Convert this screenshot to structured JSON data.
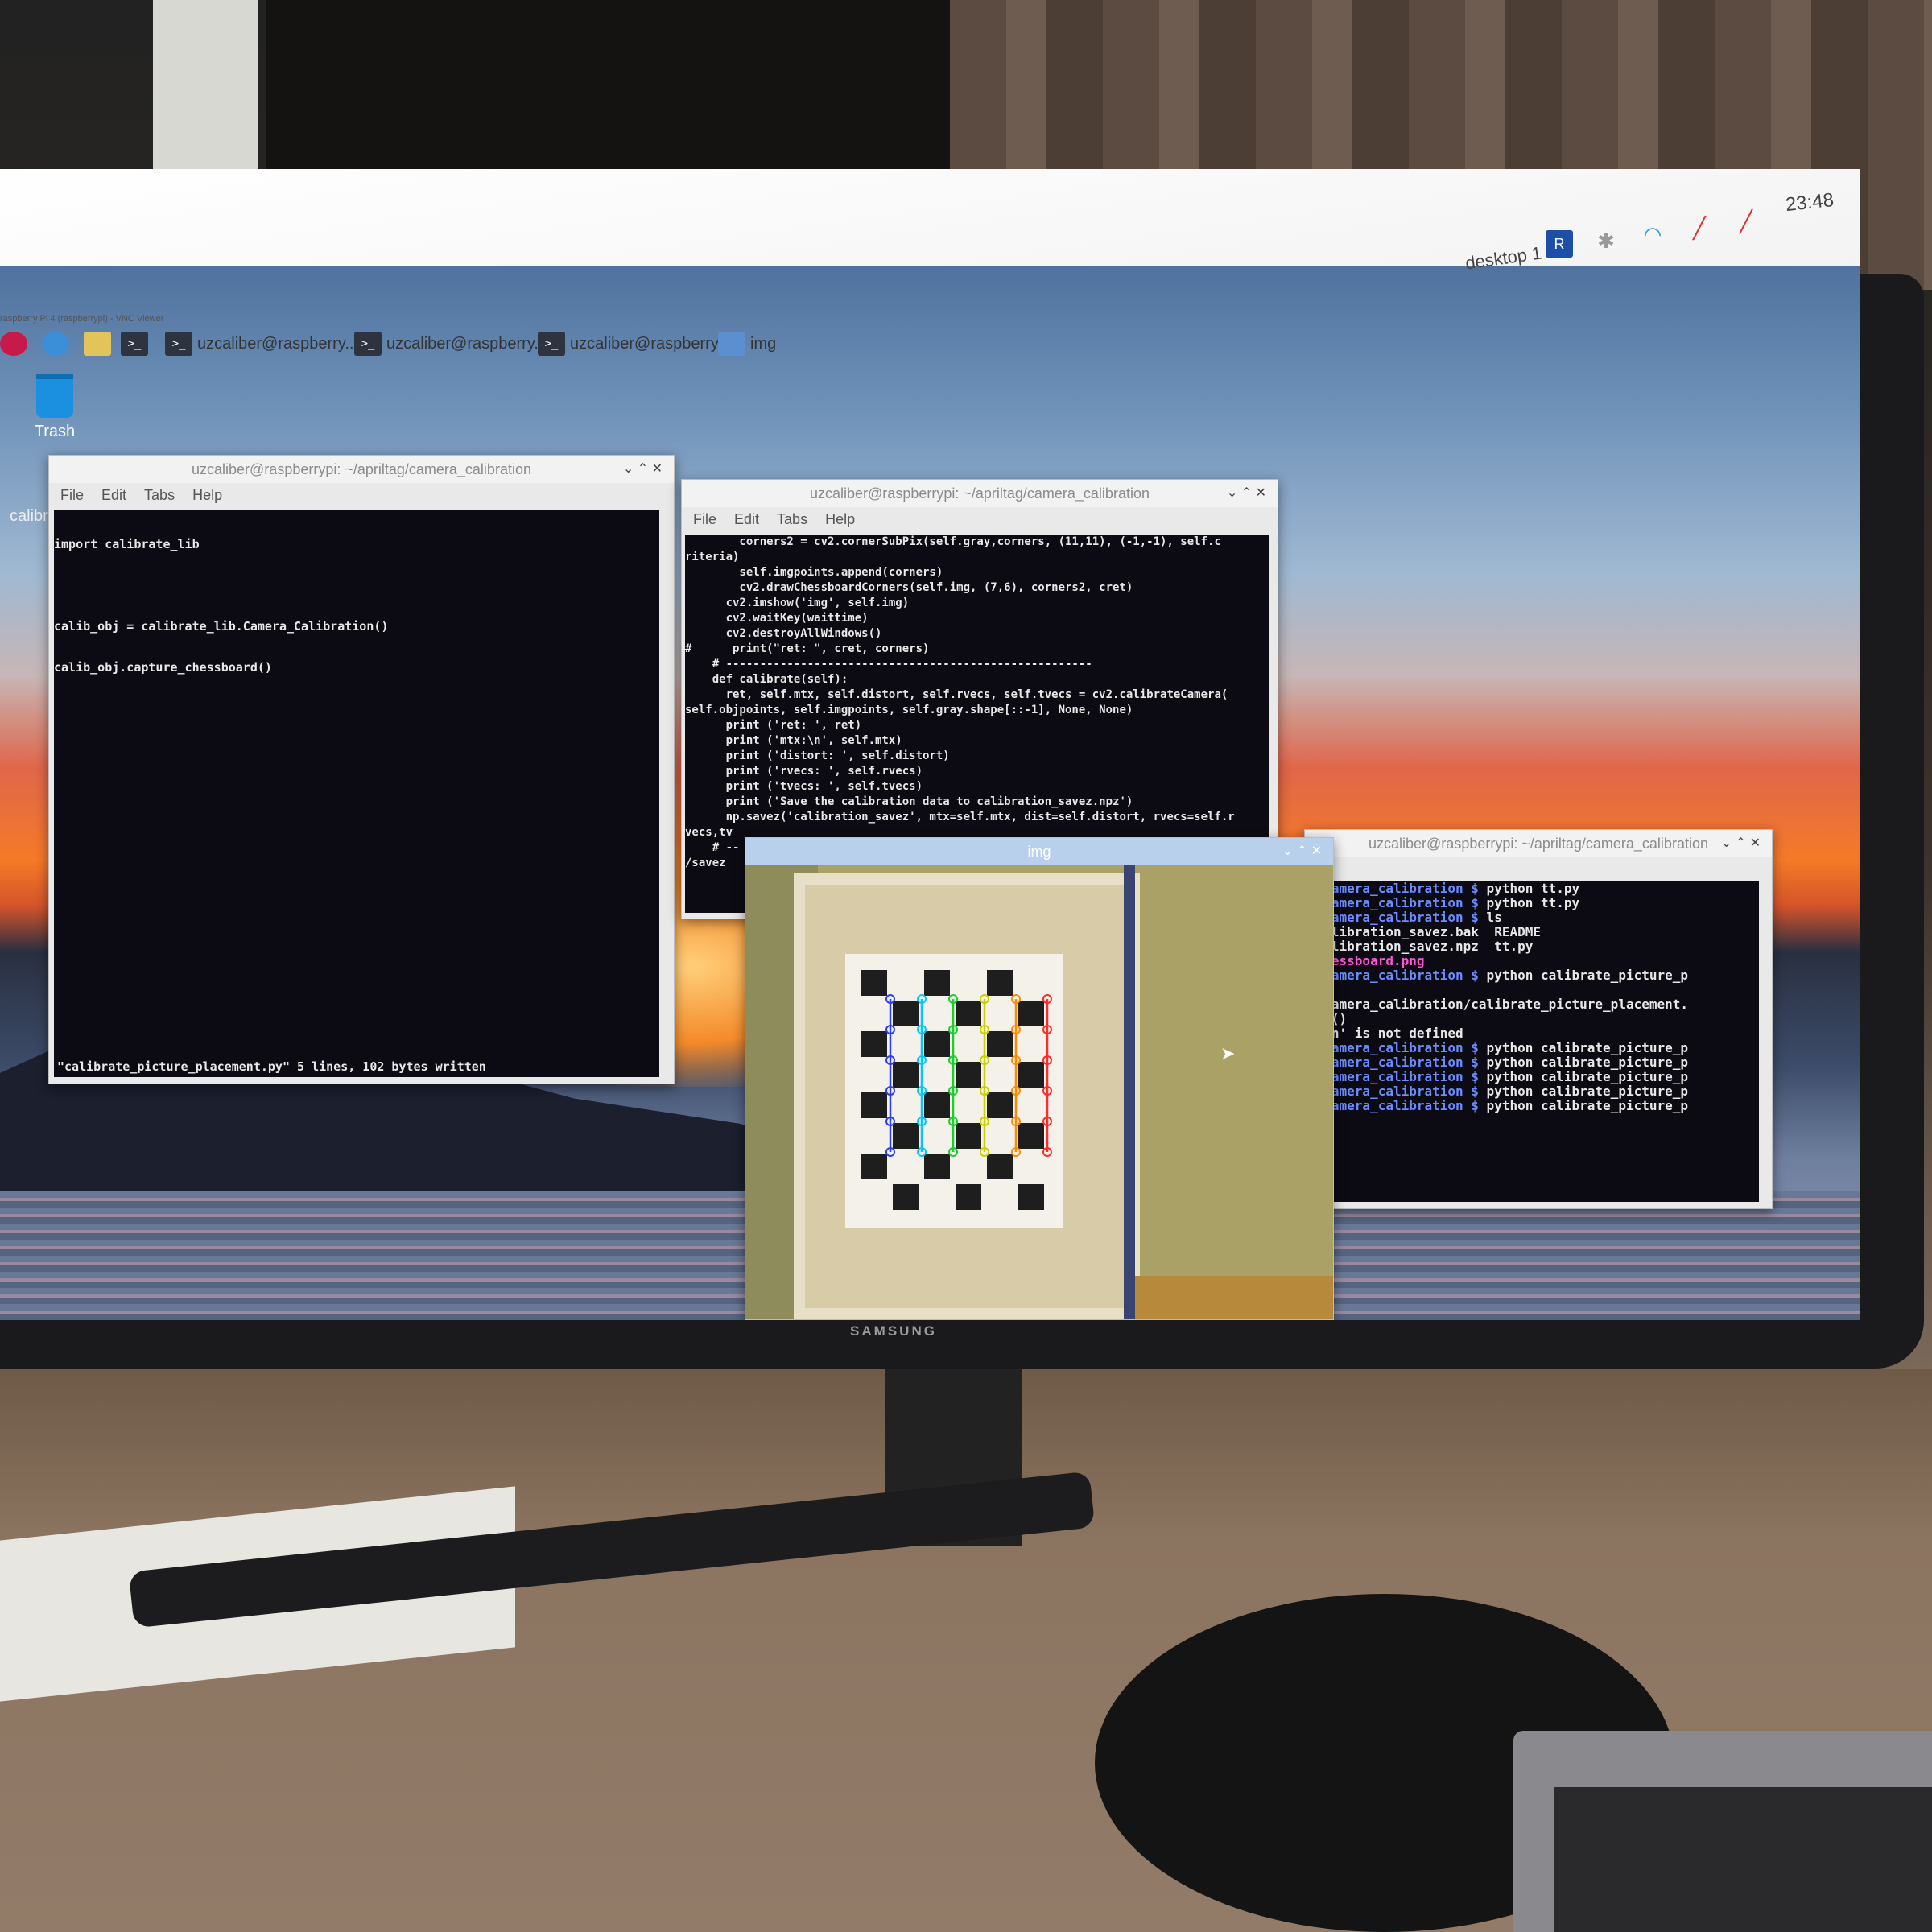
{
  "vnc_title": "raspberry Pi 4 (raspberrypi) - VNC Viewer",
  "monitor_brand": "SAMSUNG",
  "panel": {
    "taskbar": [
      {
        "icon": "raspberry-menu-icon"
      },
      {
        "icon": "browser-globe-icon"
      },
      {
        "icon": "file-manager-icon"
      },
      {
        "icon": "terminal-icon"
      },
      {
        "icon": "terminal-icon",
        "label": "uzcaliber@raspberry..."
      },
      {
        "icon": "terminal-icon",
        "label": "uzcaliber@raspberry..."
      },
      {
        "icon": "terminal-icon",
        "label": "uzcaliber@raspberry..."
      },
      {
        "icon": "image-window-icon",
        "label": "img"
      }
    ],
    "desktop_label": "desktop 1",
    "clock": "23:48",
    "tray_icons": [
      "vnc-icon",
      "bluetooth-icon",
      "wifi-icon",
      "volume-muted-icon",
      "network-muted-icon"
    ]
  },
  "desktop": {
    "trash_label": "Trash",
    "calib_label": "calibr"
  },
  "menu": {
    "file": "File",
    "edit": "Edit",
    "tabs": "Tabs",
    "help": "Help"
  },
  "window1": {
    "title": "uzcaliber@raspberrypi: ~/apriltag/camera_calibration",
    "lines": [
      "import calibrate_lib",
      "",
      "calib_obj = calibrate_lib.Camera_Calibration()",
      "calib_obj.capture_chessboard()"
    ],
    "status": "\"calibrate_picture_placement.py\" 5 lines, 102 bytes written"
  },
  "window2": {
    "title": "uzcaliber@raspberrypi: ~/apriltag/camera_calibration",
    "lines": [
      "        corners2 = cv2.cornerSubPix(self.gray,corners, (11,11), (-1,-1), self.c",
      "riteria)",
      "        self.imgpoints.append(corners)",
      "        cv2.drawChessboardCorners(self.img, (7,6), corners2, cret)",
      "      cv2.imshow('img', self.img)",
      "      cv2.waitKey(waittime)",
      "      cv2.destroyAllWindows()",
      "#      print(\"ret: \", cret, corners)",
      "",
      "    # ------------------------------------------------------",
      "    def calibrate(self):",
      "      ret, self.mtx, self.distort, self.rvecs, self.tvecs = cv2.calibrateCamera(",
      "self.objpoints, self.imgpoints, self.gray.shape[::-1], None, None)",
      "      print ('ret: ', ret)",
      "      print ('mtx:\\n', self.mtx)",
      "      print ('distort: ', self.distort)",
      "      print ('rvecs: ', self.rvecs)",
      "      print ('tvecs: ', self.tvecs)",
      "      print ('Save the calibration data to calibration_savez.npz')",
      "      np.savez('calibration_savez', mtx=self.mtx, dist=self.distort, rvecs=self.r",
      "vecs,tv",
      "",
      "    # --",
      "/savez"
    ]
  },
  "window3": {
    "title": "uzcaliber@raspberrypi: ~/apriltag/camera_calibration",
    "lines": [
      {
        "prompt": "g/camera_calibration $",
        "cmd": " python tt.py"
      },
      {
        "prompt": "g/camera_calibration $",
        "cmd": " python tt.py"
      },
      {
        "prompt": "g/camera_calibration $",
        "cmd": " ls"
      },
      {
        "text": " calibration_savez.bak  README"
      },
      {
        "text": " calibration_savez.npz  tt.py"
      },
      {
        "pink": " chessboard.png"
      },
      {
        "prompt": "g/camera_calibration $",
        "cmd": " python calibrate_picture_p"
      },
      {
        "text": ""
      },
      {
        "text": "t):"
      },
      {
        "text": "g/camera_calibration/calibrate_picture_placement."
      },
      {
        "text": ""
      },
      {
        "text": "ion()"
      },
      {
        "text": "tion' is not defined"
      },
      {
        "prompt": "g/camera_calibration $",
        "cmd": " python calibrate_picture_p"
      },
      {
        "text": ""
      },
      {
        "prompt": "g/camera_calibration $",
        "cmd": " python calibrate_picture_p"
      },
      {
        "text": ""
      },
      {
        "prompt": "g/camera_calibration $",
        "cmd": " python calibrate_picture_p"
      },
      {
        "text": ""
      },
      {
        "prompt": "g/camera_calibration $",
        "cmd": " python calibrate_picture_p"
      },
      {
        "text": ""
      },
      {
        "prompt": "g/camera_calibration $",
        "cmd": " python calibrate_picture_p"
      }
    ]
  },
  "img_window": {
    "title": "img",
    "chessboard_corner_colors": [
      "#2a3cff",
      "#00c8ff",
      "#18d02a",
      "#c8d000",
      "#ff8a00",
      "#ff2a2a"
    ]
  }
}
